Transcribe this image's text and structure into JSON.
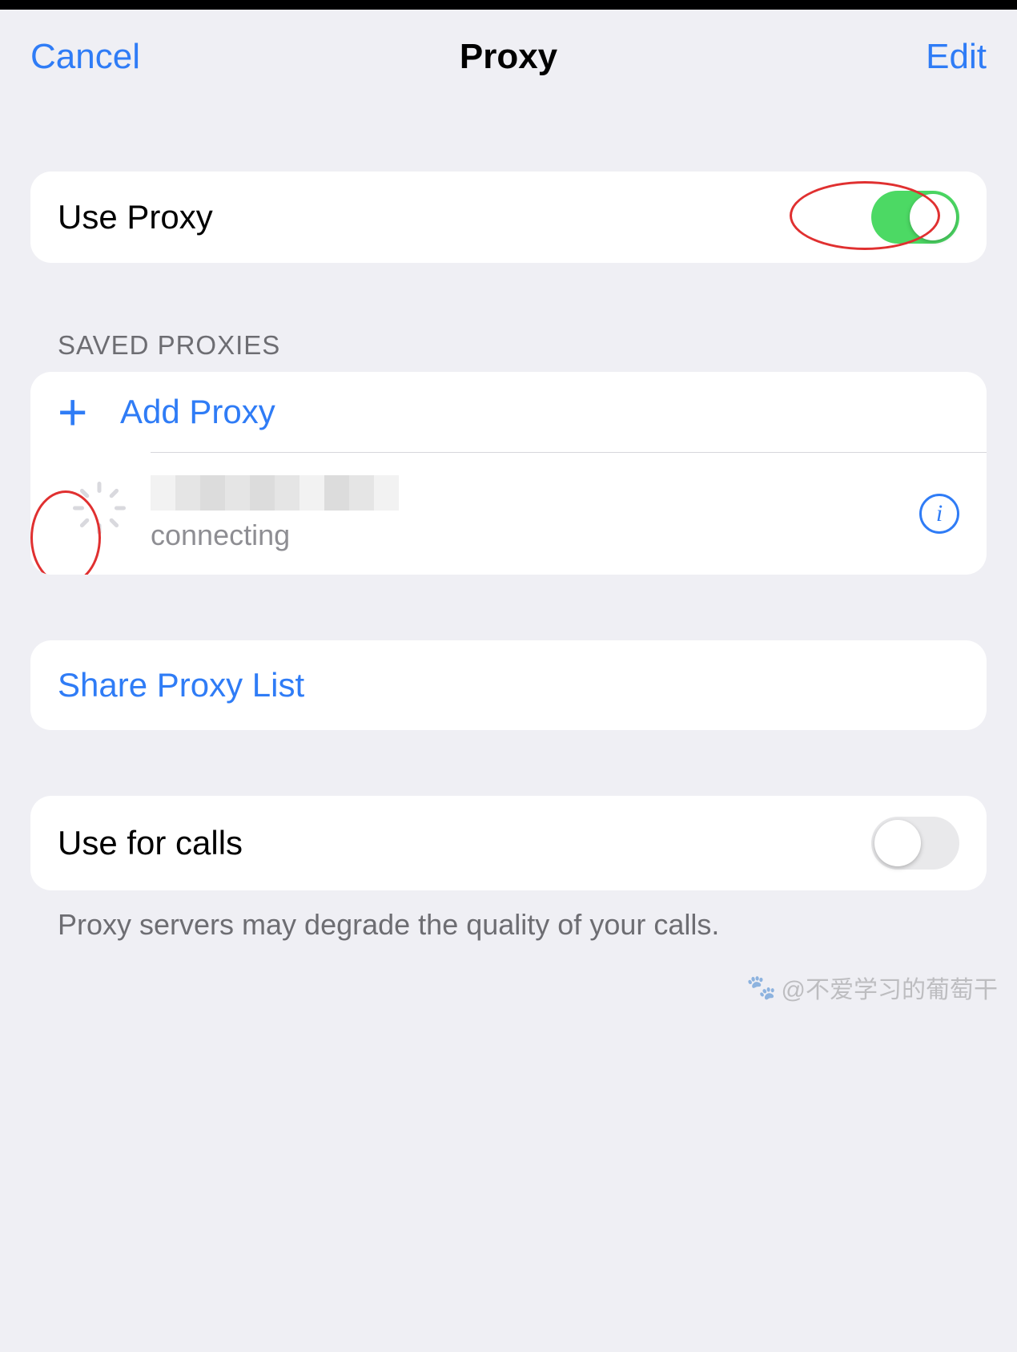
{
  "header": {
    "cancel": "Cancel",
    "title": "Proxy",
    "edit": "Edit"
  },
  "useProxy": {
    "label": "Use Proxy",
    "on": true
  },
  "savedProxies": {
    "header": "SAVED PROXIES",
    "addLabel": "Add Proxy",
    "entry": {
      "status": "connecting"
    }
  },
  "share": {
    "label": "Share Proxy List"
  },
  "calls": {
    "label": "Use for calls",
    "on": false,
    "footer": "Proxy servers may degrade the quality of your calls."
  },
  "watermark": "@不爱学习的葡萄干"
}
